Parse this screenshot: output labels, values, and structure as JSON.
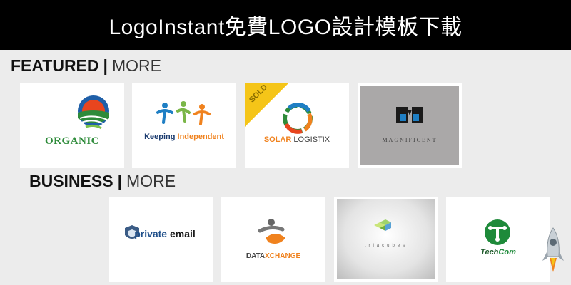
{
  "header": {
    "title": "LogoInstant免費LOGO設計模板下載"
  },
  "featured": {
    "heading": "FEATURED",
    "separator": "|",
    "more_label": "MORE",
    "logos": [
      {
        "name": "ORGANIC",
        "icon": "organic-sun-field-icon"
      },
      {
        "name": "Keeping Independent",
        "name_part1": "Keeping",
        "name_part2": "Independent",
        "icon": "people-figures-icon"
      },
      {
        "name": "SOLAR LOGISTIX",
        "name_part1": "SOLAR",
        "name_part2": "LOGISTIX",
        "badge": "SOLD",
        "icon": "solar-ring-icon"
      },
      {
        "name": "MAGNIFICENT",
        "icon": "mirror-book-icon"
      }
    ]
  },
  "business": {
    "heading": "BUSINESS",
    "separator": "|",
    "more_label": "MORE",
    "logos": [
      {
        "name": "private email",
        "name_part1": "private",
        "name_part2": "email",
        "icon": "shield-icon"
      },
      {
        "name": "DATAXCHANGE",
        "name_part1": "DATA",
        "name_part2": "XCHANGE",
        "icon": "person-swoosh-icon"
      },
      {
        "name": "triacubes",
        "icon": "cubes-icon"
      },
      {
        "name": "TechCom",
        "name_part1": "Tech",
        "name_part2": "Com",
        "icon": "t-circle-icon"
      }
    ]
  },
  "colors": {
    "header_bg": "#000000",
    "page_bg": "#ececec",
    "organic_green": "#2e8b3a",
    "orange": "#f0821e",
    "blue": "#1f7fc4",
    "sold_yellow": "#f5c518",
    "techcom_green": "#1e8a3a",
    "rocket_gray": "#9aa4ad"
  },
  "floating": {
    "icon": "rocket-icon"
  }
}
